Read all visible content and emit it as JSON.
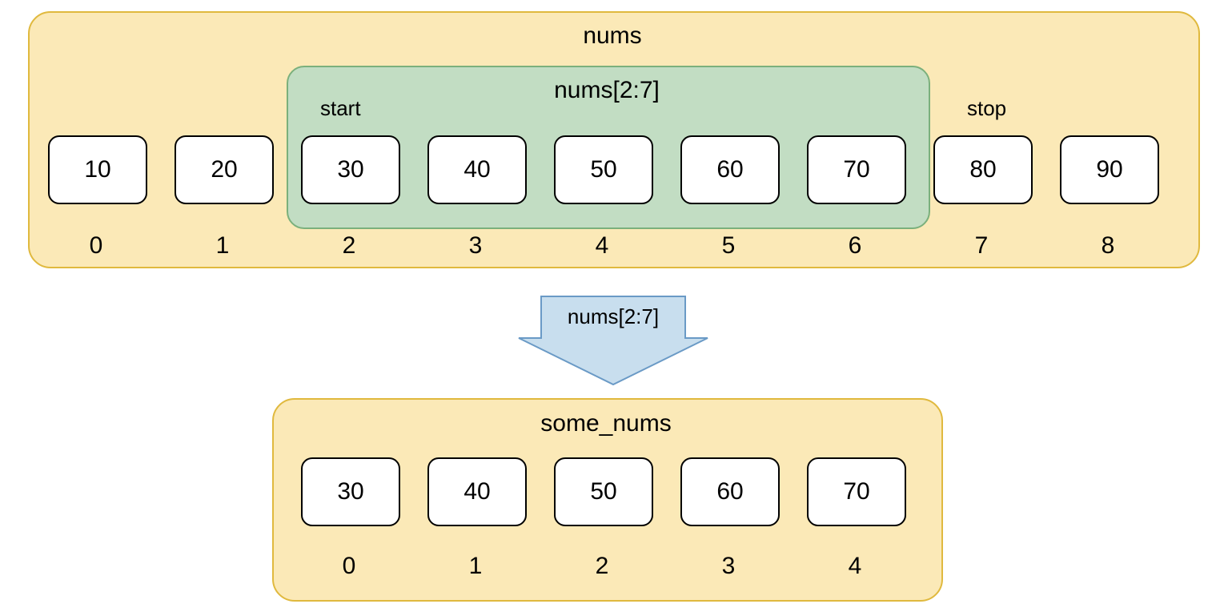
{
  "top": {
    "title": "nums",
    "slice_label": "nums[2:7]",
    "start_label": "start",
    "stop_label": "stop",
    "values": [
      "10",
      "20",
      "30",
      "40",
      "50",
      "60",
      "70",
      "80",
      "90"
    ],
    "indices": [
      "0",
      "1",
      "2",
      "3",
      "4",
      "5",
      "6",
      "7",
      "8"
    ],
    "slice_start_index": 2,
    "slice_end_index": 6
  },
  "arrow": {
    "label": "nums[2:7]"
  },
  "bottom": {
    "title": "some_nums",
    "values": [
      "30",
      "40",
      "50",
      "60",
      "70"
    ],
    "indices": [
      "0",
      "1",
      "2",
      "3",
      "4"
    ]
  }
}
